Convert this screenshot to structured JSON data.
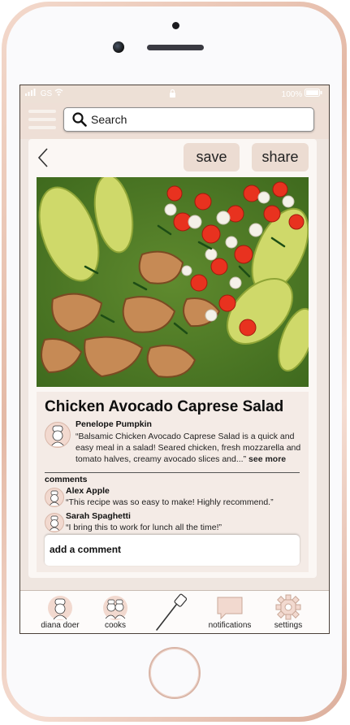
{
  "status": {
    "left": "GS",
    "right": "100%"
  },
  "search": {
    "placeholder": "Search"
  },
  "actions": {
    "save": "save",
    "share": "share"
  },
  "recipe": {
    "title": "Chicken Avocado Caprese Salad",
    "author": "Penelope Pumpkin",
    "description": "“Balsamic Chicken Avocado Caprese Salad is a quick and easy meal in a salad! Seared chicken, fresh mozzarella and tomato halves, creamy avocado slices and...”",
    "see_more": "see more"
  },
  "comments": {
    "heading": "comments",
    "items": [
      {
        "name": "Alex Apple",
        "text": "“This recipe was so easy to make! Highly recommend.”"
      },
      {
        "name": "Sarah Spaghetti",
        "text": "“I bring this to work for lunch all the time!”"
      }
    ],
    "add_placeholder": "add a comment"
  },
  "tabs": [
    {
      "label": "diana doer",
      "icon": "chef-avatar-icon"
    },
    {
      "label": "cooks",
      "icon": "two-chefs-icon"
    },
    {
      "label": "",
      "icon": "spatula-icon"
    },
    {
      "label": "notifications",
      "icon": "speech-bubble-icon"
    },
    {
      "label": "settings",
      "icon": "gear-icon"
    }
  ],
  "colors": {
    "accent": "#ecdcd2",
    "frame": "#e4b9a6",
    "background": "#efe6e0"
  }
}
